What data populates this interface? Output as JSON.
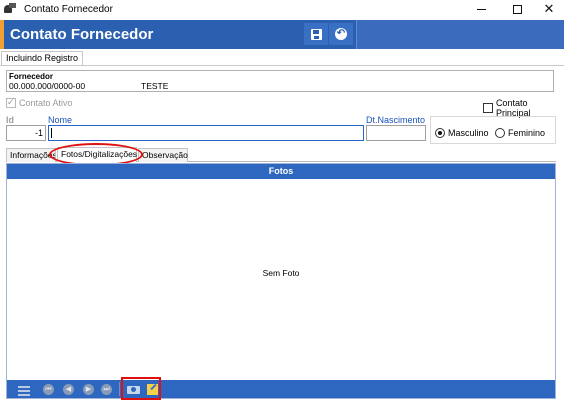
{
  "window": {
    "title": "Contato Fornecedor"
  },
  "header": {
    "title": "Contato Fornecedor",
    "save_icon": "save-icon",
    "back_icon": "back-icon"
  },
  "status": {
    "mode": "Incluindo Registro"
  },
  "fornecedor": {
    "label": "Fornecedor",
    "cnpj": "00.000.000/0000-00",
    "name": "TESTE"
  },
  "checks": {
    "ativo": {
      "label": "Contato Ativo",
      "checked": true,
      "enabled": false
    },
    "principal": {
      "label": "Contato Principal",
      "checked": false
    }
  },
  "fields": {
    "id": {
      "label": "Id",
      "value": "-1"
    },
    "nome": {
      "label": "Nome",
      "value": ""
    },
    "nascimento": {
      "label": "Dt.Nascimento",
      "value": ""
    }
  },
  "sexo": {
    "options": [
      {
        "label": "Masculino",
        "selected": true
      },
      {
        "label": "Feminino",
        "selected": false
      }
    ]
  },
  "tabs": [
    {
      "label": "Informações",
      "active": false
    },
    {
      "label": "Fotos/Digitalizações",
      "active": true
    },
    {
      "label": "Observação",
      "active": false
    }
  ],
  "fotos": {
    "title": "Fotos",
    "empty_text": "Sem Foto",
    "toolbar_icons": [
      "settings-icon",
      "first-icon",
      "prev-icon",
      "next-icon",
      "last-icon",
      "camera-icon",
      "edit-icon"
    ]
  },
  "colors": {
    "brand": "#2b5fb0",
    "accent": "#f0a030",
    "highlight": "#e01010"
  }
}
